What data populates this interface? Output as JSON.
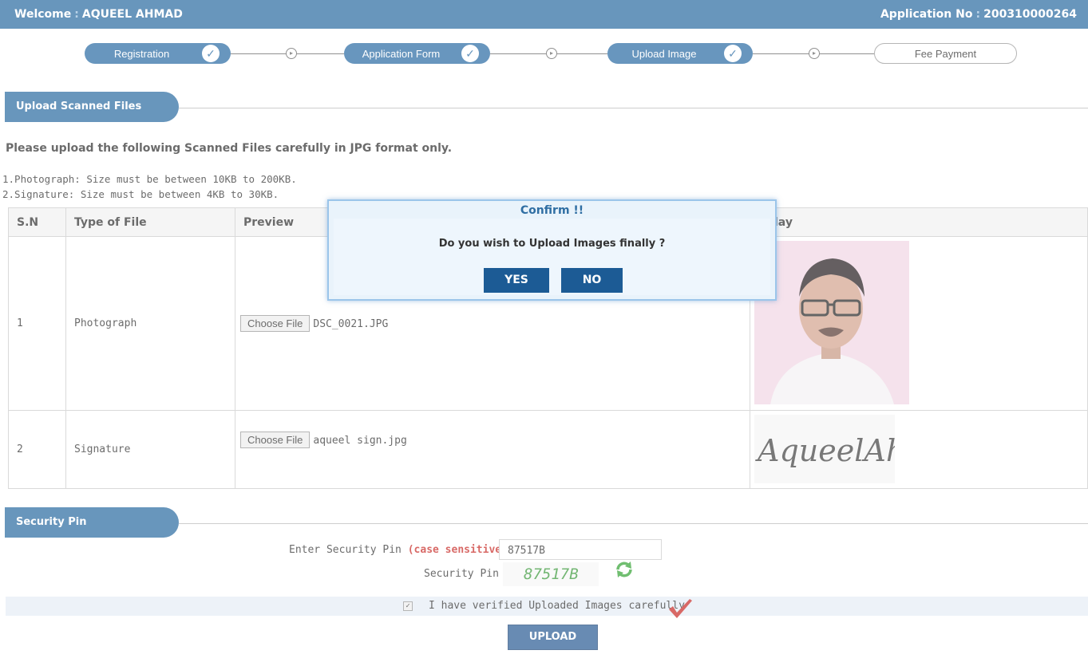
{
  "header": {
    "welcome_label": "Welcome",
    "user_name": "AQUEEL AHMAD",
    "app_no_label": "Application No",
    "app_no": "200310000264",
    "separator": ":"
  },
  "steps": [
    {
      "label": "Registration",
      "done": true
    },
    {
      "label": "Application Form",
      "done": true
    },
    {
      "label": "Upload Image",
      "done": true
    },
    {
      "label": "Fee Payment",
      "done": false
    }
  ],
  "upload_section": {
    "title": "Upload Scanned Files",
    "instruction": "Please upload the following Scanned Files carefully in JPG format only.",
    "rules": [
      "1.Photograph: Size must be between 10KB to 200KB.",
      "2.Signature: Size must be between 4KB to 30KB."
    ],
    "columns": [
      "S.N",
      "Type of File",
      "Preview",
      "lay"
    ],
    "rows": [
      {
        "sn": "1",
        "type": "Photograph",
        "button": "Choose File",
        "file": "DSC_0021.JPG"
      },
      {
        "sn": "2",
        "type": "Signature",
        "button": "Choose File",
        "file": "aqueel sign.jpg"
      }
    ],
    "signature_text": "AqueelAhmad"
  },
  "security_section": {
    "title": "Security Pin",
    "enter_label": "Enter Security Pin",
    "case_label": "(case sensitive)",
    "colon": ":",
    "pin_value": "87517B",
    "pin_label": "Security Pin :",
    "captcha": "87517B",
    "verify_text": "I have verified Uploaded Images carefully",
    "upload_button": "UPLOAD"
  },
  "dialog": {
    "title": "Confirm !!",
    "message": "Do you wish to Upload Images finally ?",
    "yes": "YES",
    "no": "NO"
  },
  "colors": {
    "primary": "#2f6ea3",
    "dialog_button": "#1c5b95",
    "captcha": "#3d9a3d",
    "accent_red": "#c9302c"
  }
}
